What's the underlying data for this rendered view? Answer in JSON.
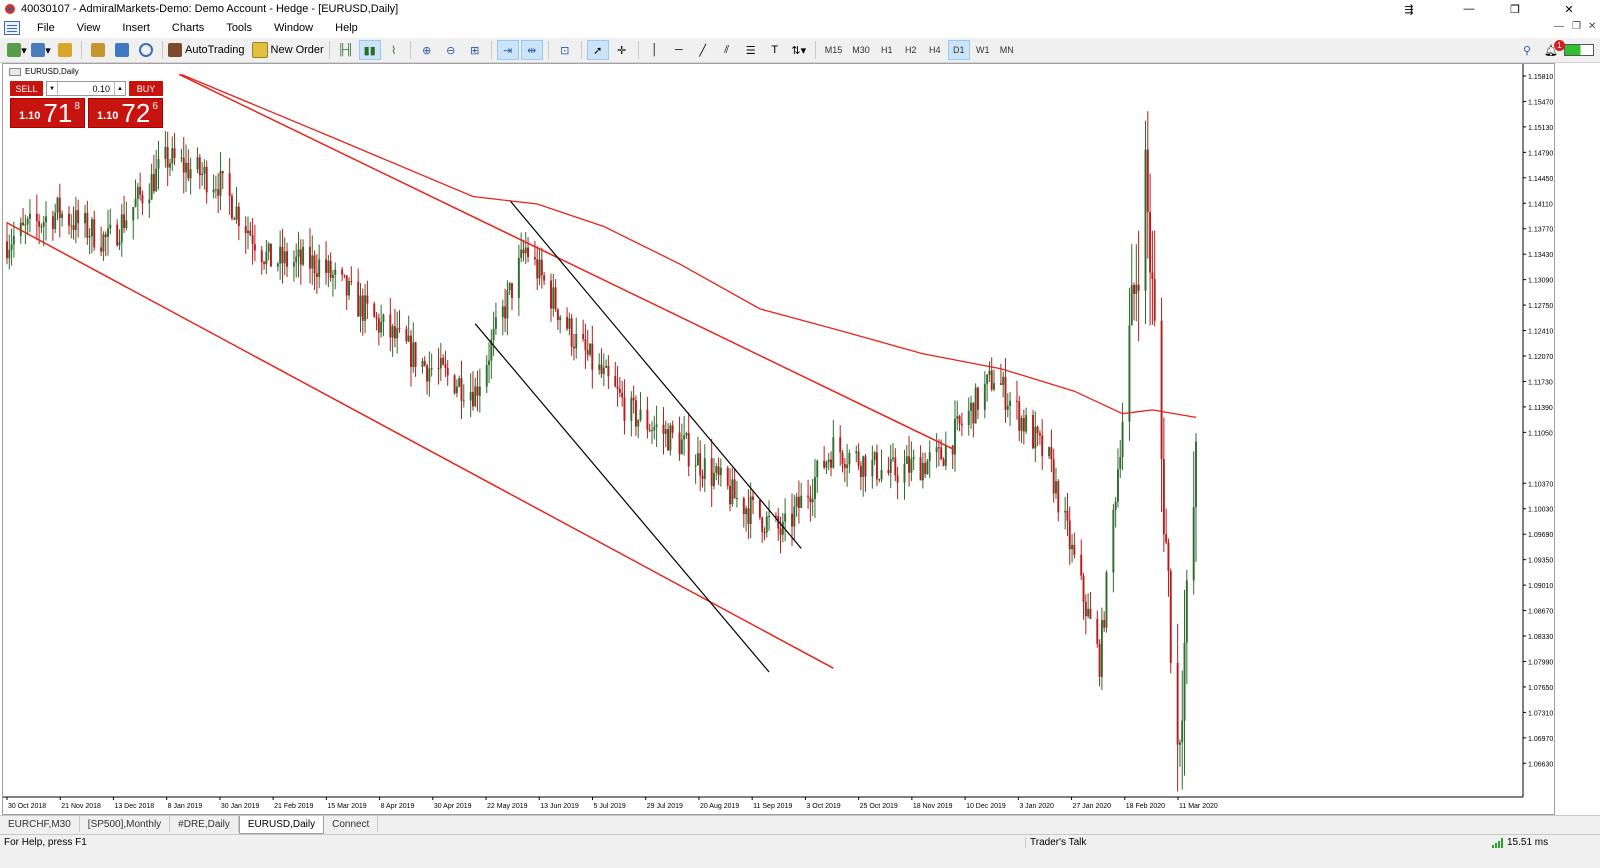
{
  "window": {
    "title": "40030107 - AdmiralMarkets-Demo: Demo Account - Hedge - [EURUSD,Daily]"
  },
  "menu": [
    "File",
    "View",
    "Insert",
    "Charts",
    "Tools",
    "Window",
    "Help"
  ],
  "toolbar": {
    "autotrading_label": "AutoTrading",
    "neworder_label": "New Order",
    "timeframes": [
      "M15",
      "M30",
      "H1",
      "H2",
      "H4",
      "D1",
      "W1",
      "MN"
    ],
    "active_timeframe": "D1",
    "notification_count": "1"
  },
  "chart": {
    "label": "EURUSD,Daily",
    "trade_panel": {
      "sell_label": "SELL",
      "buy_label": "BUY",
      "volume": "0.10",
      "bid_prefix": "1.10",
      "bid_big": "71",
      "bid_sup": "8",
      "ask_prefix": "1.10",
      "ask_big": "72",
      "ask_sup": "6"
    },
    "colors": {
      "bull": "#2e6b2e",
      "bear": "#b51c1c",
      "trendline_red": "#e8231a",
      "trendline_black": "#000000",
      "ma": "#e8231a"
    }
  },
  "chart_data": {
    "type": "candlestick",
    "symbol": "EURUSD",
    "timeframe": "Daily",
    "title": "EURUSD,Daily",
    "ylim": [
      1.0618,
      1.1597
    ],
    "y_ticks": [
      "1.15810",
      "1.15470",
      "1.15130",
      "1.14790",
      "1.14450",
      "1.14110",
      "1.13770",
      "1.13430",
      "1.13090",
      "1.12750",
      "1.12410",
      "1.12070",
      "1.11730",
      "1.11390",
      "1.11050",
      "1.10370",
      "1.10030",
      "1.09690",
      "1.09350",
      "1.09010",
      "1.08670",
      "1.08330",
      "1.07990",
      "1.07650",
      "1.07310",
      "1.06970",
      "1.06630"
    ],
    "x_labels": [
      "30 Oct 2018",
      "21 Nov 2018",
      "13 Dec 2018",
      "8 Jan 2019",
      "30 Jan 2019",
      "21 Feb 2019",
      "15 Mar 2019",
      "8 Apr 2019",
      "30 Apr 2019",
      "22 May 2019",
      "13 Jun 2019",
      "5 Jul 2019",
      "29 Jul 2019",
      "20 Aug 2019",
      "11 Sep 2019",
      "3 Oct 2019",
      "25 Oct 2019",
      "18 Nov 2019",
      "10 Dec 2019",
      "3 Jan 2020",
      "27 Jan 2020",
      "18 Feb 2020",
      "11 Mar 2020"
    ],
    "path_key_points": [
      {
        "date": "2018-10-30",
        "close": 1.136
      },
      {
        "date": "2018-11-21",
        "close": 1.14
      },
      {
        "date": "2018-12-13",
        "close": 1.136
      },
      {
        "date": "2019-01-08",
        "close": 1.147
      },
      {
        "date": "2019-01-30",
        "close": 1.144
      },
      {
        "date": "2019-02-21",
        "close": 1.1335
      },
      {
        "date": "2019-03-15",
        "close": 1.133
      },
      {
        "date": "2019-04-08",
        "close": 1.1255
      },
      {
        "date": "2019-04-30",
        "close": 1.1195
      },
      {
        "date": "2019-05-22",
        "close": 1.116
      },
      {
        "date": "2019-06-13",
        "close": 1.135
      },
      {
        "date": "2019-07-05",
        "close": 1.1225
      },
      {
        "date": "2019-07-29",
        "close": 1.113
      },
      {
        "date": "2019-08-20",
        "close": 1.109
      },
      {
        "date": "2019-09-11",
        "close": 1.102
      },
      {
        "date": "2019-10-03",
        "close": 1.097
      },
      {
        "date": "2019-10-25",
        "close": 1.1085
      },
      {
        "date": "2019-11-18",
        "close": 1.105
      },
      {
        "date": "2019-12-10",
        "close": 1.107
      },
      {
        "date": "2020-01-03",
        "close": 1.118
      },
      {
        "date": "2020-01-27",
        "close": 1.1065
      },
      {
        "date": "2020-02-18",
        "close": 1.08
      },
      {
        "date": "2020-03-09",
        "close": 1.145
      },
      {
        "date": "2020-03-23",
        "close": 1.068
      },
      {
        "date": "2020-03-31",
        "close": 1.105
      }
    ]
  },
  "tabs": [
    "EURCHF,M30",
    "[SP500],Monthly",
    "#DRE,Daily",
    "EURUSD,Daily",
    "Connect"
  ],
  "active_tab": "EURUSD,Daily",
  "status": {
    "help": "For Help, press F1",
    "community": "Trader's Talk",
    "ping": "15.51 ms"
  }
}
